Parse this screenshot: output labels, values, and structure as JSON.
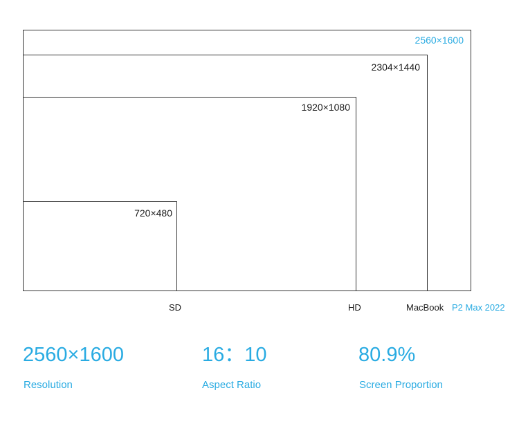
{
  "colors": {
    "accent": "#29abe2",
    "text": "#1a1a1a",
    "border": "#333333"
  },
  "resolutions": [
    {
      "name": "sd",
      "label": "720×480"
    },
    {
      "name": "hd",
      "label": "1920×1080"
    },
    {
      "name": "macbook",
      "label": "2304×1440"
    },
    {
      "name": "p2max",
      "label": "2560×1600"
    }
  ],
  "axis_labels": {
    "sd": "SD",
    "hd": "HD",
    "macbook": "MacBook",
    "p2max": "P2 Max 2022"
  },
  "stats": [
    {
      "value": "2560×1600",
      "label": "Resolution"
    },
    {
      "value": "16：10",
      "label": "Aspect Ratio"
    },
    {
      "value": "80.9%",
      "label": "Screen Proportion"
    }
  ]
}
